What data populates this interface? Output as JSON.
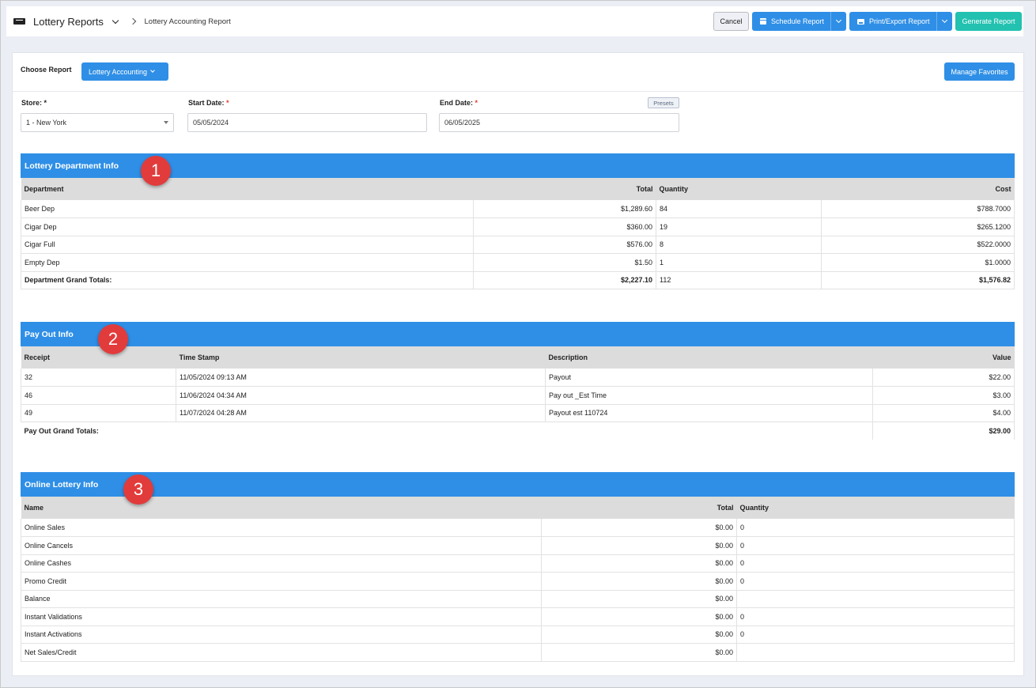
{
  "header": {
    "app_title": "Lottery Reports",
    "breadcrumb": "Lottery Accounting Report",
    "buttons": {
      "cancel": "Cancel",
      "schedule": "Schedule Report",
      "print_export": "Print/Export Report",
      "generate": "Generate Report"
    }
  },
  "filters": {
    "choose_report_label": "Choose Report",
    "report_selected": "Lottery Accounting",
    "manage_favorites": "Manage Favorites",
    "store_label": "Store: *",
    "store_value": "1 - New York",
    "start_label": "Start Date:",
    "start_value": "05/05/2024",
    "end_label": "End Date:",
    "end_value": "06/05/2025",
    "required_mark": "*",
    "presets": "Presets"
  },
  "department": {
    "title": "Lottery Department Info",
    "marker": "1",
    "headers": [
      "Department",
      "Total",
      "Quantity",
      "Cost"
    ],
    "rows": [
      [
        "Beer Dep",
        "$1,289.60",
        "84",
        "$788.7000"
      ],
      [
        "Cigar Dep",
        "$360.00",
        "19",
        "$265.1200"
      ],
      [
        "Cigar Full",
        "$576.00",
        "8",
        "$522.0000"
      ],
      [
        "Empty Dep",
        "$1.50",
        "1",
        "$1.0000"
      ]
    ],
    "total": [
      "Department Grand Totals:",
      "$2,227.10",
      "112",
      "$1,576.82"
    ]
  },
  "payout": {
    "title": "Pay Out Info",
    "marker": "2",
    "headers": [
      "Receipt",
      "Time Stamp",
      "Description",
      "Value"
    ],
    "rows": [
      [
        "32",
        "11/05/2024 09:13 AM",
        "Payout",
        "$22.00"
      ],
      [
        "46",
        "11/06/2024 04:34 AM",
        "Pay out _Est Time",
        "$3.00"
      ],
      [
        "49",
        "11/07/2024 04:28 AM",
        "Payout est 110724",
        "$4.00"
      ]
    ],
    "total": [
      "Pay Out Grand Totals:",
      "$29.00"
    ]
  },
  "online": {
    "title": "Online Lottery Info",
    "marker": "3",
    "headers": [
      "Name",
      "Total",
      "Quantity"
    ],
    "rows": [
      [
        "Online Sales",
        "$0.00",
        "0"
      ],
      [
        "Online Cancels",
        "$0.00",
        "0"
      ],
      [
        "Online Cashes",
        "$0.00",
        "0"
      ],
      [
        "Promo Credit",
        "$0.00",
        "0"
      ],
      [
        "Balance",
        "$0.00",
        ""
      ],
      [
        "Instant Validations",
        "$0.00",
        "0"
      ],
      [
        "Instant Activations",
        "$0.00",
        "0"
      ],
      [
        "Net Sales/Credit",
        "$0.00",
        ""
      ]
    ]
  }
}
